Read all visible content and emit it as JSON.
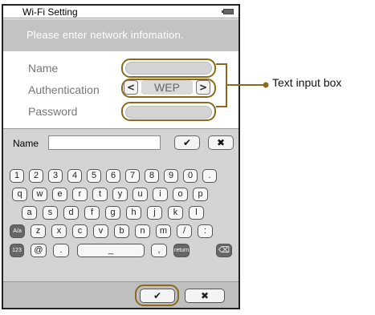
{
  "status_bar": {
    "title": "Wi-Fi Setting",
    "battery_icon": "battery-icon"
  },
  "header": {
    "text": "Please enter network infomation."
  },
  "form": {
    "name_label": "Name",
    "auth_label": "Authentication",
    "auth_value": "WEP",
    "prev_arrow": "<",
    "next_arrow": ">",
    "password_label": "Password"
  },
  "keyboard": {
    "name_label": "Name",
    "confirm": "✔",
    "cancel": "✖",
    "rows": [
      [
        "1",
        "2",
        "3",
        "4",
        "5",
        "6",
        "7",
        "8",
        "9",
        "0",
        "."
      ],
      [
        "q",
        "w",
        "e",
        "r",
        "t",
        "y",
        "u",
        "i",
        "o",
        "p"
      ],
      [
        "a",
        "s",
        "d",
        "f",
        "g",
        "h",
        "j",
        "k",
        "l"
      ],
      [
        "A/a",
        "z",
        "x",
        "c",
        "v",
        "b",
        "n",
        "m",
        "/",
        ":"
      ],
      [
        "123",
        "@",
        ".",
        "_",
        ",",
        "return",
        "⌫"
      ]
    ]
  },
  "footer": {
    "ok": "✔",
    "cancel": "✖"
  },
  "callout": {
    "text": "Text input box"
  },
  "colors": {
    "annotation": "#8b6a1e",
    "header_bg": "#c3c3c3",
    "keyboard_bg": "#d4d4d4"
  }
}
